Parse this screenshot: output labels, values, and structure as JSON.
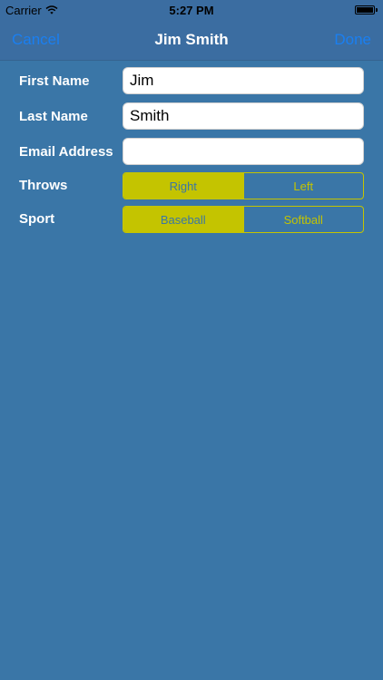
{
  "status_bar": {
    "carrier": "Carrier",
    "time": "5:27 PM"
  },
  "nav": {
    "cancel_label": "Cancel",
    "title": "Jim Smith",
    "done_label": "Done"
  },
  "form": {
    "first_name": {
      "label": "First Name",
      "value": "Jim"
    },
    "last_name": {
      "label": "Last Name",
      "value": "Smith"
    },
    "email": {
      "label": "Email Address",
      "value": ""
    },
    "throws": {
      "label": "Throws",
      "options": [
        "Right",
        "Left"
      ],
      "selected": "Right"
    },
    "sport": {
      "label": "Sport",
      "options": [
        "Baseball",
        "Softball"
      ],
      "selected": "Baseball"
    }
  },
  "colors": {
    "background": "#3a76a7",
    "nav_button": "#1a7ff1",
    "segment_accent": "#c4c400"
  }
}
